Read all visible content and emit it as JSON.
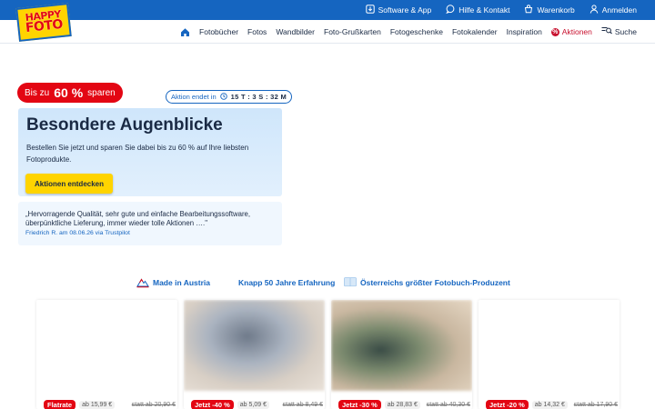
{
  "header": {
    "logo_line1": "HAPPY",
    "logo_line2": "FOTO",
    "top_links": [
      {
        "label": "Software & App",
        "icon": "download-icon"
      },
      {
        "label": "Hilfe & Kontakt",
        "icon": "chat-icon"
      },
      {
        "label": "Warenkorb",
        "icon": "cart-icon"
      },
      {
        "label": "Anmelden",
        "icon": "user-icon"
      }
    ],
    "nav": [
      "Fotobücher",
      "Fotos",
      "Wandbilder",
      "Foto-Grußkarten",
      "Fotogeschenke",
      "Fotokalender",
      "Inspiration"
    ],
    "promo_label": "Aktionen",
    "search_label": "Suche",
    "colors": {
      "primary": "#1565c0",
      "accent": "#ffd400",
      "sale": "#e30613"
    }
  },
  "promo": {
    "save_prefix": "Bis zu",
    "save_value": "60 %",
    "save_suffix": "sparen",
    "timer_label": "Aktion endet in",
    "timer_value": "15 T : 3 S : 32 M"
  },
  "hero": {
    "title": "Besondere Augenblicke",
    "text": "Bestellen Sie jetzt und sparen Sie dabei bis zu 60 % auf Ihre liebsten Fotoprodukte.",
    "cta": "Aktionen entdecken"
  },
  "review": {
    "text": "„Hervorragende Qualität, sehr gute und einfache Bearbeitungssoftware, überpünktliche Lieferung, immer wieder tolle Aktionen ….\"",
    "source": "Friedrich R. am 08.06.26 via Trustpilot"
  },
  "usps": [
    "Made in Austria",
    "Knapp 50 Jahre Erfahrung",
    "Österreichs größter Fotobuch-Produzent"
  ],
  "products": [
    {
      "badge": "Flatrate",
      "from": "ab 15,99 €",
      "old": "statt ab 20,90 €"
    },
    {
      "badge": "Jetzt -40 %",
      "from": "ab 5,09 €",
      "old": "statt ab 8,49 €"
    },
    {
      "badge": "Jetzt -30 %",
      "from": "ab 28,83 €",
      "old": "statt ab 40,30 €"
    },
    {
      "badge": "Jetzt -20 %",
      "from": "ab 14,32 €",
      "old": "statt ab 17,90 €"
    }
  ]
}
